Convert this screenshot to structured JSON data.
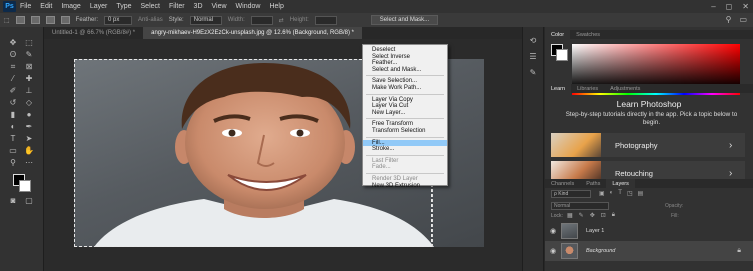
{
  "menubar": {
    "app_logo": "Ps",
    "items": [
      "File",
      "Edit",
      "Image",
      "Layer",
      "Type",
      "Select",
      "Filter",
      "3D",
      "View",
      "Window",
      "Help"
    ],
    "window_controls": [
      "–",
      "◻",
      "✕"
    ]
  },
  "options": {
    "feather_label": "Feather:",
    "feather_value": "0 px",
    "antialias_label": "Anti-alias",
    "style_label": "Style:",
    "style_value": "Normal",
    "width_label": "Width:",
    "height_label": "Height:",
    "select_mask_button": "Select and Mask..."
  },
  "tabs": [
    {
      "label": "Untitled-1 @ 66.7% (RGB/8#) *",
      "active": false
    },
    {
      "label": "angry-mikhaev-H9EzX2EzCk-unsplash.jpg @ 12.6% (Background, RGB/8) *",
      "active": true
    }
  ],
  "context_menu": {
    "groups": [
      [
        {
          "label": "Deselect"
        },
        {
          "label": "Select Inverse"
        },
        {
          "label": "Feather..."
        },
        {
          "label": "Select and Mask..."
        }
      ],
      [
        {
          "label": "Save Selection..."
        },
        {
          "label": "Make Work Path..."
        }
      ],
      [
        {
          "label": "Layer Via Copy"
        },
        {
          "label": "Layer Via Cut"
        },
        {
          "label": "New Layer..."
        }
      ],
      [
        {
          "label": "Free Transform"
        },
        {
          "label": "Transform Selection"
        }
      ],
      [
        {
          "label": "Fill...",
          "highlighted": true
        },
        {
          "label": "Stroke..."
        }
      ],
      [
        {
          "label": "Last Filter",
          "disabled": true
        },
        {
          "label": "Fade...",
          "disabled": true
        }
      ],
      [
        {
          "label": "Render 3D Layer",
          "disabled": true
        },
        {
          "label": "New 3D Extrusion"
        }
      ]
    ]
  },
  "color_panel": {
    "tabs": [
      "Color",
      "Swatches"
    ]
  },
  "learn_panel": {
    "tabs": [
      "Learn",
      "Libraries",
      "Adjustments"
    ],
    "title": "Learn Photoshop",
    "subtitle": "Step-by-step tutorials directly in the app. Pick a topic below to begin.",
    "cards": [
      {
        "label": "Photography"
      },
      {
        "label": "Retouching"
      }
    ]
  },
  "layers_panel": {
    "tabs": [
      "Channels",
      "Paths",
      "Layers"
    ],
    "kind_label": "ρ Kind",
    "blend_mode": "Normal",
    "opacity_label": "Opacity:",
    "lock_label": "Lock:",
    "fill_label": "Fill:",
    "layers": [
      {
        "name": "Layer 1",
        "italic": false
      },
      {
        "name": "Background",
        "italic": true
      }
    ]
  },
  "colors": {
    "menubar": "#323232",
    "panel": "#323232",
    "canvas_bg": "#2b2b2b",
    "context_highlight": "#91c9f7",
    "ps_blue": "#31a8ff"
  }
}
